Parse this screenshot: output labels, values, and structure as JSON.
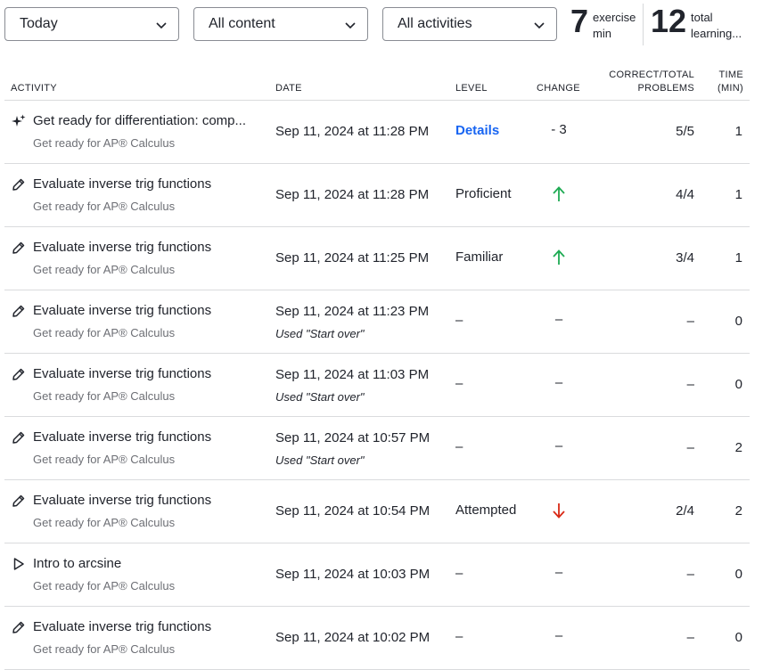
{
  "filters": {
    "date_range": "Today",
    "content": "All content",
    "activities": "All activities"
  },
  "stats": {
    "exercise_value": "7",
    "exercise_label_line1": "exercise",
    "exercise_label_line2": "min",
    "total_value": "12",
    "total_label_line1": "total",
    "total_label_line2": "learning..."
  },
  "table": {
    "headers": {
      "activity": "ACTIVITY",
      "date": "DATE",
      "level": "LEVEL",
      "change": "CHANGE",
      "score_line1": "CORRECT/TOTAL",
      "score_line2": "PROBLEMS",
      "time_line1": "TIME",
      "time_line2": "(MIN)"
    },
    "rows": [
      {
        "icon": "sparkle-icon",
        "title": "Get ready for differentiation: comp...",
        "course": "Get ready for AP® Calculus",
        "date": "Sep 11, 2024 at 11:28 PM",
        "note": "",
        "level": "Details",
        "change": "- 3",
        "change_kind": "text",
        "score": "5/5",
        "time": "1"
      },
      {
        "icon": "pencil-icon",
        "title": "Evaluate inverse trig functions",
        "course": "Get ready for AP® Calculus",
        "date": "Sep 11, 2024 at 11:28 PM",
        "note": "",
        "level": "Proficient",
        "change": "",
        "change_kind": "up",
        "score": "4/4",
        "time": "1"
      },
      {
        "icon": "pencil-icon",
        "title": "Evaluate inverse trig functions",
        "course": "Get ready for AP® Calculus",
        "date": "Sep 11, 2024 at 11:25 PM",
        "note": "",
        "level": "Familiar",
        "change": "",
        "change_kind": "up",
        "score": "3/4",
        "time": "1"
      },
      {
        "icon": "pencil-icon",
        "title": "Evaluate inverse trig functions",
        "course": "Get ready for AP® Calculus",
        "date": "Sep 11, 2024 at 11:23 PM",
        "note": "Used \"Start over\"",
        "level": "–",
        "change": "–",
        "change_kind": "text",
        "score": "–",
        "time": "0"
      },
      {
        "icon": "pencil-icon",
        "title": "Evaluate inverse trig functions",
        "course": "Get ready for AP® Calculus",
        "date": "Sep 11, 2024 at 11:03 PM",
        "note": "Used \"Start over\"",
        "level": "–",
        "change": "–",
        "change_kind": "text",
        "score": "–",
        "time": "0"
      },
      {
        "icon": "pencil-icon",
        "title": "Evaluate inverse trig functions",
        "course": "Get ready for AP® Calculus",
        "date": "Sep 11, 2024 at 10:57 PM",
        "note": "Used \"Start over\"",
        "level": "–",
        "change": "–",
        "change_kind": "text",
        "score": "–",
        "time": "2"
      },
      {
        "icon": "pencil-icon",
        "title": "Evaluate inverse trig functions",
        "course": "Get ready for AP® Calculus",
        "date": "Sep 11, 2024 at 10:54 PM",
        "note": "",
        "level": "Attempted",
        "change": "",
        "change_kind": "down",
        "score": "2/4",
        "time": "2"
      },
      {
        "icon": "play-icon",
        "title": "Intro to arcsine",
        "course": "Get ready for AP® Calculus",
        "date": "Sep 11, 2024 at 10:03 PM",
        "note": "",
        "level": "–",
        "change": "–",
        "change_kind": "text",
        "score": "–",
        "time": "0"
      },
      {
        "icon": "pencil-icon",
        "title": "Evaluate inverse trig functions",
        "course": "Get ready for AP® Calculus",
        "date": "Sep 11, 2024 at 10:02 PM",
        "note": "",
        "level": "–",
        "change": "–",
        "change_kind": "text",
        "score": "–",
        "time": "0"
      }
    ]
  },
  "colors": {
    "link": "#1865f2",
    "up_arrow": "#1fab54",
    "down_arrow": "#d92916",
    "muted_text": "#6d6f75",
    "border": "#dadbdd"
  }
}
